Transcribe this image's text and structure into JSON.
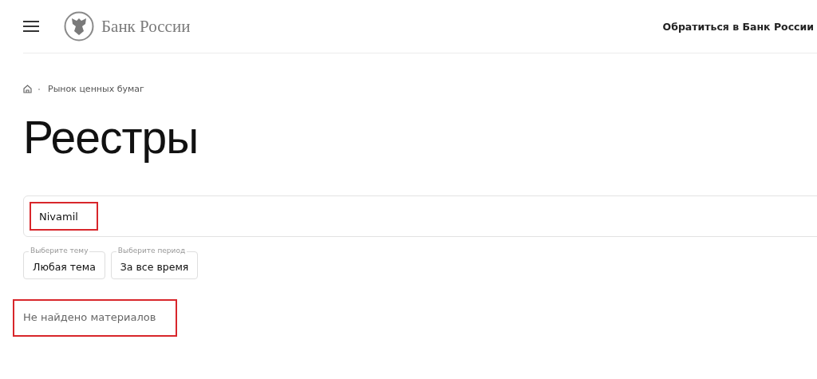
{
  "header": {
    "brand": "Банк России",
    "contact_link": "Обратиться в Банк России"
  },
  "breadcrumbs": [
    "Рынок ценных бумаг"
  ],
  "title": "Реестры",
  "search": {
    "value": "Nivamil",
    "highlighted": true
  },
  "filters": [
    {
      "label": "Выберите тему",
      "value": "Любая тема"
    },
    {
      "label": "Выберите период",
      "value": "За все время"
    }
  ],
  "results": {
    "message": "Не найдено материалов",
    "highlighted": true
  }
}
